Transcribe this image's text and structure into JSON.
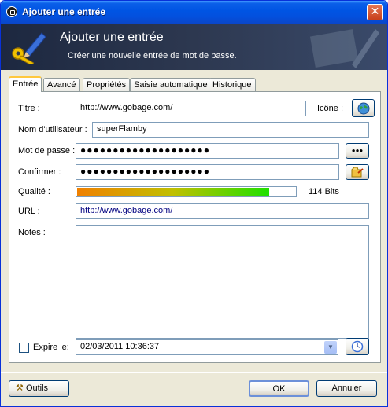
{
  "window": {
    "title": "Ajouter une entrée"
  },
  "banner": {
    "title": "Ajouter une entrée",
    "subtitle": "Créer une nouvelle entrée de mot de passe."
  },
  "tabs": [
    "Entrée",
    "Avancé",
    "Propriétés",
    "Saisie automatique",
    "Historique"
  ],
  "form": {
    "title_label": "Titre :",
    "title_value": "http://www.gobage.com/",
    "icon_label": "Icône :",
    "username_label": "Nom d'utilisateur :",
    "username_value": "superFlamby",
    "password_label": "Mot de passe :",
    "password_value": "●●●●●●●●●●●●●●●●●●●●",
    "reveal_label": "●●●",
    "confirm_label": "Confirmer :",
    "confirm_value": "●●●●●●●●●●●●●●●●●●●●",
    "quality_label": "Qualité :",
    "quality_bits": "114 Bits",
    "quality_fraction": 0.88,
    "url_label": "URL :",
    "url_value": "http://www.gobage.com/",
    "notes_label": "Notes :",
    "notes_value": "",
    "expire_label": "Expire le:",
    "expire_checked": false,
    "expire_value": "02/03/2011 10:36:37"
  },
  "buttons": {
    "tools": "Outils",
    "ok": "OK",
    "cancel": "Annuler"
  },
  "colors": {
    "titlebar": "#0054E3",
    "quality_start": "#F08000",
    "quality_end": "#20E000",
    "url_text": "#000080"
  }
}
